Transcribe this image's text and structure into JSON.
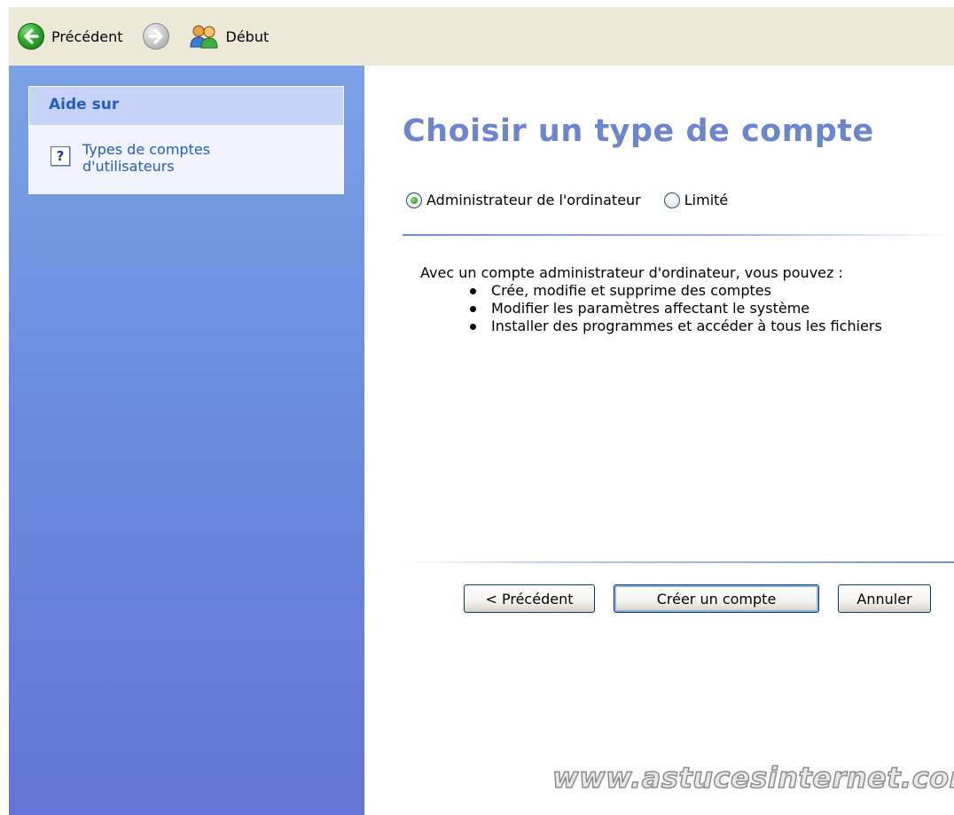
{
  "toolbar": {
    "back_label": "Précédent",
    "home_label": "Début"
  },
  "sidebar": {
    "help_header": "Aide sur",
    "help_item": "Types de comptes d'utilisateurs"
  },
  "main": {
    "title": "Choisir un type de compte",
    "radio_admin": "Administrateur de l'ordinateur",
    "radio_limited": "Limité",
    "selected_radio": "admin",
    "description_intro": "Avec un compte administrateur d'ordinateur, vous pouvez :",
    "bullets": [
      "Crée, modifie et supprime des comptes",
      "Modifier les paramètres affectant le système",
      "Installer des programmes et accéder à tous les fichiers"
    ],
    "btn_previous": "< Précédent",
    "btn_create": "Créer un compte",
    "btn_cancel": "Annuler"
  },
  "watermark": "www.astucesinternet.com",
  "icons": {
    "back": "back-arrow-icon",
    "forward": "forward-arrow-icon",
    "home": "users-icon",
    "help": "help-question-icon"
  },
  "colors": {
    "title": "#6b86cf",
    "sidebar_link": "#215dc6",
    "toolbar_bg": "#ece9d8",
    "sidebar_top": "#7ba2e7",
    "sidebar_bottom": "#6375d6"
  }
}
